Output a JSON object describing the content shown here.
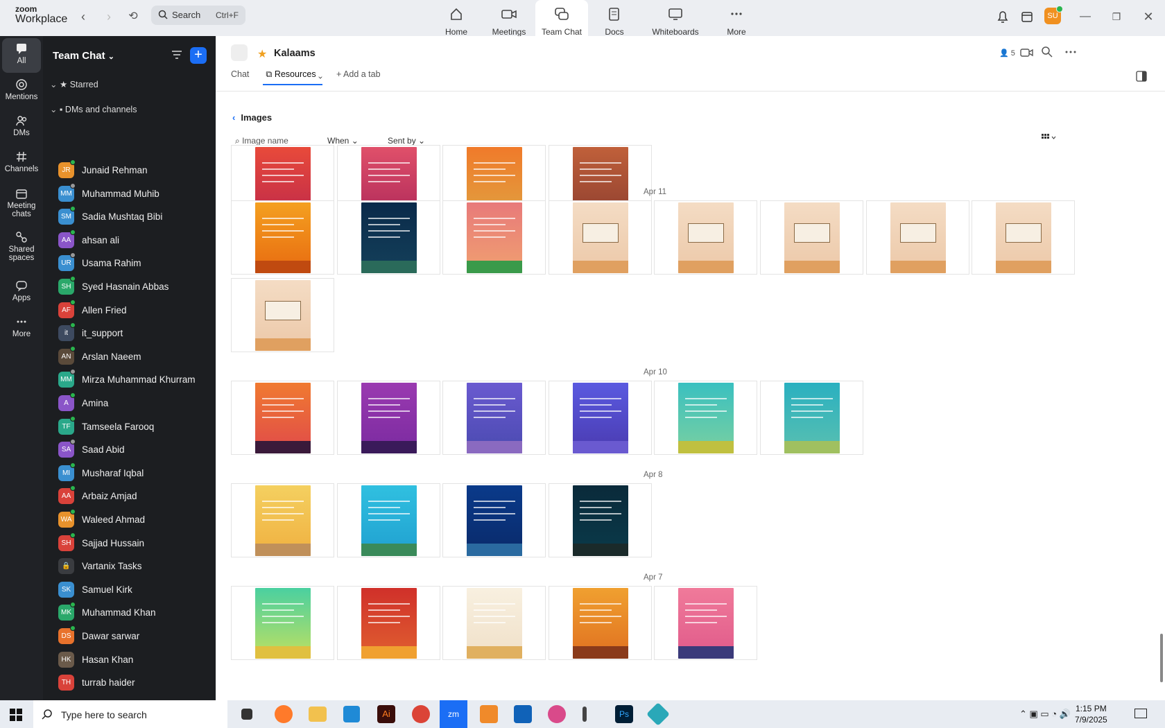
{
  "app": {
    "logo_line1": "zoom",
    "logo_line2": "Workplace"
  },
  "search": {
    "placeholder": "Search",
    "shortcut": "Ctrl+F"
  },
  "top_tabs": [
    {
      "label": "Home",
      "icon": "home-icon"
    },
    {
      "label": "Meetings",
      "icon": "video-camera-icon"
    },
    {
      "label": "Team Chat",
      "icon": "chat-bubbles-icon",
      "active": true
    },
    {
      "label": "Docs",
      "icon": "document-icon"
    },
    {
      "label": "Whiteboards",
      "icon": "whiteboard-icon"
    },
    {
      "label": "More",
      "icon": "ellipsis-icon"
    }
  ],
  "user_avatar": "SU",
  "rail": [
    {
      "label": "All",
      "icon": "chat-icon",
      "active": true
    },
    {
      "label": "Mentions",
      "icon": "at-icon"
    },
    {
      "label": "DMs",
      "icon": "people-icon"
    },
    {
      "label": "Channels",
      "icon": "hash-icon"
    },
    {
      "label": "Meeting chats",
      "icon": "calendar-icon"
    },
    {
      "label": "Shared spaces",
      "icon": "shared-spaces-icon"
    },
    {
      "label": "Apps",
      "icon": "apps-icon"
    },
    {
      "label": "More",
      "icon": "ellipsis-icon"
    }
  ],
  "sidebar": {
    "title": "Team Chat",
    "sections": {
      "starred": "Starred",
      "dms": "DMs and channels"
    },
    "contacts": [
      {
        "initials": "JR",
        "name": "Junaid Rehman",
        "color": "#e8922c",
        "status": "on"
      },
      {
        "initials": "MM",
        "name": "Muhammad Muhib",
        "color": "#3a8fd0",
        "status": "off"
      },
      {
        "initials": "SM",
        "name": "Sadia Mushtaq Bibi",
        "color": "#3a8fd0",
        "status": "on"
      },
      {
        "initials": "AA",
        "name": "ahsan ali",
        "color": "#8a55c8",
        "status": "on"
      },
      {
        "initials": "UR",
        "name": "Usama Rahim",
        "color": "#3a8fd0",
        "status": "off"
      },
      {
        "initials": "SH",
        "name": "Syed Hasnain Abbas",
        "color": "#2aa86a",
        "status": "on"
      },
      {
        "initials": "AF",
        "name": "Allen Fried",
        "color": "#d9423a",
        "status": "on"
      },
      {
        "initials": "it",
        "name": "it_support",
        "color": "#3d4a60",
        "status": "on"
      },
      {
        "initials": "AN",
        "name": "Arslan Naeem",
        "color": "#5a4a3a",
        "status": "on"
      },
      {
        "initials": "MM",
        "name": "Mirza Muhammad Khurram",
        "color": "#2aa88a",
        "status": "off"
      },
      {
        "initials": "A",
        "name": "Amina",
        "color": "#8a55c8",
        "status": "on"
      },
      {
        "initials": "TF",
        "name": "Tamseela Farooq",
        "color": "#2aa88a",
        "status": "on"
      },
      {
        "initials": "SA",
        "name": "Saad Abid",
        "color": "#8a55c8",
        "status": "off"
      },
      {
        "initials": "MI",
        "name": "Musharaf Iqbal",
        "color": "#3a8fd0",
        "status": "on"
      },
      {
        "initials": "AA",
        "name": "Arbaiz Amjad",
        "color": "#d9423a",
        "status": "on"
      },
      {
        "initials": "WA",
        "name": "Waleed Ahmad",
        "color": "#e8922c",
        "status": "on"
      },
      {
        "initials": "SH",
        "name": "Sajjad Hussain",
        "color": "#d9423a",
        "status": "on"
      },
      {
        "initials": "🔒",
        "name": "Vartanix Tasks",
        "color": "#3a3c40",
        "status": "none"
      },
      {
        "initials": "SK",
        "name": "Samuel Kirk",
        "color": "#3a8fd0",
        "status": "none"
      },
      {
        "initials": "MK",
        "name": "Muhammad Khan",
        "color": "#2aa86a",
        "status": "on"
      },
      {
        "initials": "DS",
        "name": "Dawar sarwar",
        "color": "#e8722c",
        "status": "on"
      },
      {
        "initials": "HK",
        "name": "Hasan Khan",
        "color": "#6a5a4a",
        "status": "none"
      },
      {
        "initials": "TH",
        "name": "turrab haider",
        "color": "#d9423a",
        "status": "none"
      }
    ]
  },
  "channel": {
    "name": "Kalaams",
    "member_count": "5"
  },
  "subtabs": {
    "chat": "Chat",
    "resources": "Resources",
    "add": "Add a tab"
  },
  "images_view": {
    "back_label": "Images",
    "search_placeholder": "Image name",
    "filter_when": "When",
    "filter_sent_by": "Sent by",
    "groups": [
      {
        "date": "",
        "palettes": [
          "red",
          "pinkred",
          "orangegreen",
          "rustbrown"
        ]
      },
      {
        "date": "Apr 11",
        "palettes": [
          "orange",
          "navy",
          "pinkgreen",
          "sand",
          "sand",
          "sand",
          "sand",
          "sand",
          "sand"
        ]
      },
      {
        "date": "Apr 10",
        "palettes": [
          "sunset",
          "purple",
          "violet",
          "indigo",
          "tealgreen",
          "tealcyan"
        ]
      },
      {
        "date": "Apr 8",
        "palettes": [
          "yellow",
          "sky",
          "deepblue",
          "midnight"
        ]
      },
      {
        "date": "Apr 7",
        "palettes": [
          "greenyellow",
          "crimson",
          "cream",
          "amber",
          "rose"
        ]
      }
    ]
  },
  "taskbar": {
    "search_placeholder": "Type here to search",
    "time": "1:15 PM",
    "date": "7/9/2025"
  }
}
